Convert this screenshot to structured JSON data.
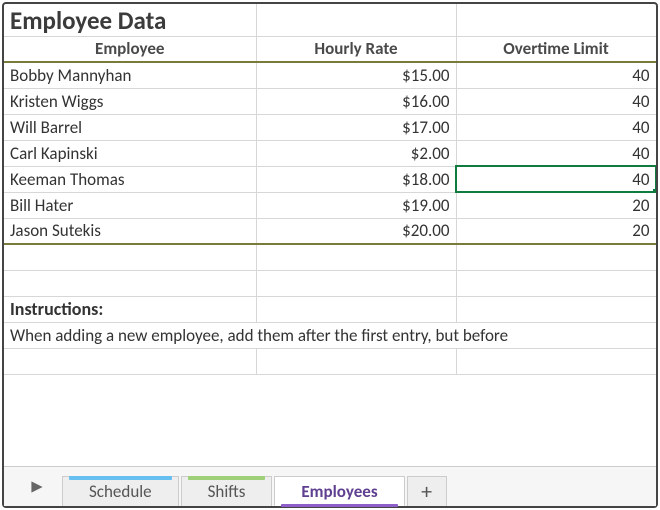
{
  "title": "Employee Data",
  "columns": {
    "employee": "Employee",
    "rate": "Hourly Rate",
    "overtime": "Overtime Limit"
  },
  "rows": [
    {
      "name": "Bobby Mannyhan",
      "rate": "$15.00",
      "ot": "40"
    },
    {
      "name": "Kristen Wiggs",
      "rate": "$16.00",
      "ot": "40"
    },
    {
      "name": "Will Barrel",
      "rate": "$17.00",
      "ot": "40"
    },
    {
      "name": "Carl Kapinski",
      "rate": "$2.00",
      "ot": "40"
    },
    {
      "name": "Keeman Thomas",
      "rate": "$18.00",
      "ot": "40"
    },
    {
      "name": "Bill Hater",
      "rate": "$19.00",
      "ot": "20"
    },
    {
      "name": "Jason Sutekis",
      "rate": "$20.00",
      "ot": "20"
    }
  ],
  "selected_cell": {
    "row_index": 4,
    "col": "ot"
  },
  "instructions": {
    "label": "Instructions:",
    "text": "When adding a new employee, add them after the first entry, but before"
  },
  "tabs": {
    "schedule": "Schedule",
    "shifts": "Shifts",
    "employees": "Employees",
    "add": "+"
  },
  "active_tab": "Employees",
  "chart_data": {
    "type": "table",
    "title": "Employee Data",
    "columns": [
      "Employee",
      "Hourly Rate",
      "Overtime Limit"
    ],
    "records": [
      [
        "Bobby Mannyhan",
        15.0,
        40
      ],
      [
        "Kristen Wiggs",
        16.0,
        40
      ],
      [
        "Will Barrel",
        17.0,
        40
      ],
      [
        "Carl Kapinski",
        2.0,
        40
      ],
      [
        "Keeman Thomas",
        18.0,
        40
      ],
      [
        "Bill Hater",
        19.0,
        20
      ],
      [
        "Jason Sutekis",
        20.0,
        20
      ]
    ]
  }
}
